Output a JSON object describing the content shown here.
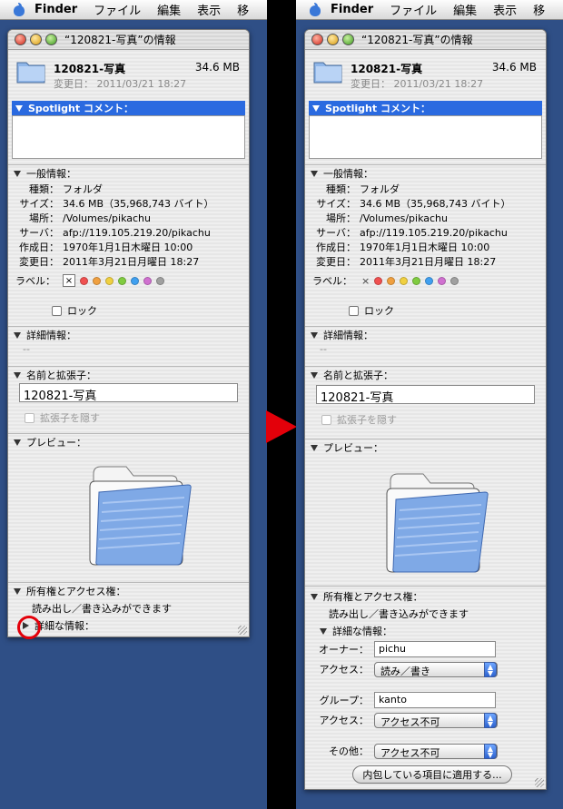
{
  "menubar": {
    "items": [
      "Finder",
      "ファイル",
      "編集",
      "表示",
      "移"
    ]
  },
  "window": {
    "title": "“120821-写真”の情報",
    "name": "120821-写真",
    "size": "34.6 MB",
    "modified_short": "変更日： 2011/03/21 18:27",
    "spotlight_label": "Spotlight コメント：",
    "general": {
      "title": "一般情報：",
      "rows": [
        {
          "k": "種類：",
          "v": "フォルダ"
        },
        {
          "k": "サイズ：",
          "v": "34.6 MB（35,968,743 バイト）"
        },
        {
          "k": "場所：",
          "v": "/Volumes/pikachu"
        },
        {
          "k": "サーバ：",
          "v": "afp://119.105.219.20/pikachu"
        },
        {
          "k": "作成日：",
          "v": "1970年1月1日木曜日 10:00"
        },
        {
          "k": "変更日：",
          "v": "2011年3月21日月曜日 18:27"
        }
      ],
      "label_key": "ラベル：",
      "label_x": "×",
      "label_colors": [
        "#f05050",
        "#f0a040",
        "#f0d040",
        "#80cc40",
        "#40a0f0",
        "#d070d0",
        "#a0a0a0"
      ],
      "lock": "ロック"
    },
    "more_info": {
      "title": "詳細情報：",
      "value": "--"
    },
    "name_ext": {
      "title": "名前と拡張子：",
      "value": "120821-写真",
      "hide_ext": "拡張子を隠す"
    },
    "preview": {
      "title": "プレビュー："
    },
    "ownership": {
      "title": "所有権とアクセス権：",
      "text": "読み出し／書き込みができます",
      "detail": "詳細な情報：",
      "owner_label": "オーナー：",
      "owner": "pichu",
      "access_label": "アクセス：",
      "owner_access": "読み／書き",
      "group_label": "グループ：",
      "group": "kanto",
      "group_access": "アクセス不可",
      "other_label": "その他：",
      "other_access": "アクセス不可",
      "apply_button": "内包している項目に適用する..."
    }
  },
  "colors": {
    "desktop": "#2f4f86",
    "highlight": "#2a6ae0",
    "annotation": "#e3000a"
  }
}
